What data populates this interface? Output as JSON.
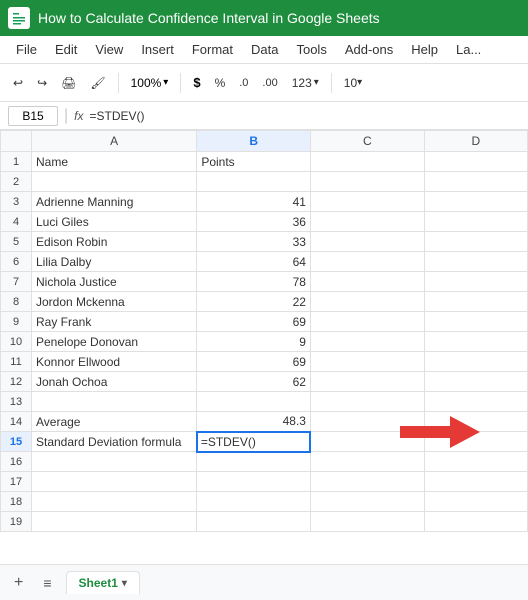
{
  "title": {
    "text": "How to Calculate Confidence Interval in Google Sheets",
    "logo_alt": "Google Sheets"
  },
  "menu": {
    "items": [
      "File",
      "Edit",
      "View",
      "Insert",
      "Format",
      "Data",
      "Tools",
      "Add-ons",
      "Help",
      "La..."
    ]
  },
  "toolbar": {
    "zoom": "100%",
    "currency": "$",
    "percent": "%",
    "decimal_decrease": ".0",
    "decimal_increase": ".00",
    "format_num": "123",
    "font_size": "10"
  },
  "formula_bar": {
    "cell_ref": "B15",
    "fx": "fx",
    "formula": "=STDEV()"
  },
  "columns": {
    "row_header": "",
    "a": "A",
    "b": "B",
    "c": "C",
    "d": "D"
  },
  "rows": [
    {
      "num": "1",
      "a": "Name",
      "b": "Points",
      "c": "",
      "d": ""
    },
    {
      "num": "2",
      "a": "",
      "b": "",
      "c": "",
      "d": ""
    },
    {
      "num": "3",
      "a": "Adrienne Manning",
      "b": "41",
      "c": "",
      "d": ""
    },
    {
      "num": "4",
      "a": "Luci Giles",
      "b": "36",
      "c": "",
      "d": ""
    },
    {
      "num": "5",
      "a": "Edison Robin",
      "b": "33",
      "c": "",
      "d": ""
    },
    {
      "num": "6",
      "a": "Lilia Dalby",
      "b": "64",
      "c": "",
      "d": ""
    },
    {
      "num": "7",
      "a": "Nichola Justice",
      "b": "78",
      "c": "",
      "d": ""
    },
    {
      "num": "8",
      "a": "Jordon Mckenna",
      "b": "22",
      "c": "",
      "d": ""
    },
    {
      "num": "9",
      "a": "Ray Frank",
      "b": "69",
      "c": "",
      "d": ""
    },
    {
      "num": "10",
      "a": "Penelope Donovan",
      "b": "9",
      "c": "",
      "d": ""
    },
    {
      "num": "11",
      "a": "Konnor Ellwood",
      "b": "69",
      "c": "",
      "d": ""
    },
    {
      "num": "12",
      "a": "Jonah Ochoa",
      "b": "62",
      "c": "",
      "d": ""
    },
    {
      "num": "13",
      "a": "",
      "b": "",
      "c": "",
      "d": ""
    },
    {
      "num": "14",
      "a": "Average",
      "b": "48.3",
      "c": "",
      "d": ""
    },
    {
      "num": "15",
      "a": "Standard Deviation formula",
      "b": "=STDEV()",
      "c": "",
      "d": ""
    },
    {
      "num": "16",
      "a": "",
      "b": "",
      "c": "",
      "d": ""
    },
    {
      "num": "17",
      "a": "",
      "b": "",
      "c": "",
      "d": ""
    },
    {
      "num": "18",
      "a": "",
      "b": "",
      "c": "",
      "d": ""
    },
    {
      "num": "19",
      "a": "",
      "b": "",
      "c": "",
      "d": ""
    }
  ],
  "bottom": {
    "add_sheet": "+",
    "sheet_list": "≡",
    "sheet_name": "Sheet1",
    "chevron": "▾"
  },
  "active_cell": "B15",
  "colors": {
    "header_green": "#1e8e3e",
    "active_blue": "#1a73e8",
    "red_arrow": "#e53935"
  }
}
